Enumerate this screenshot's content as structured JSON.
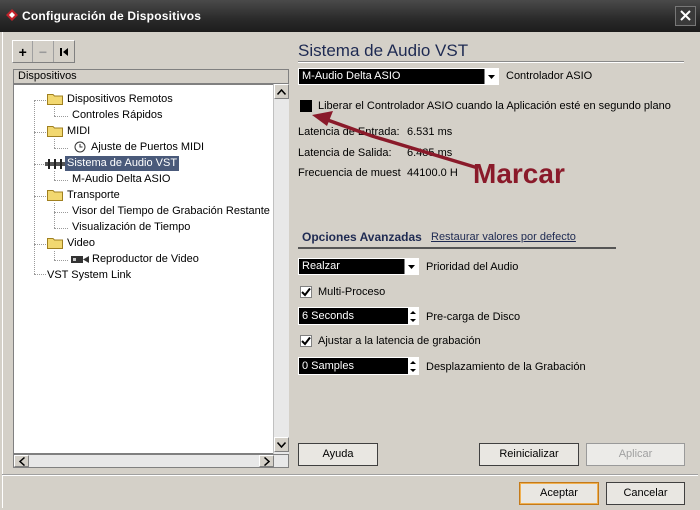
{
  "window": {
    "title": "Configuración de Dispositivos",
    "close_symbol": "✕"
  },
  "toolbar": {
    "add_symbol": "+",
    "remove_symbol": "−",
    "reset_symbol": "⏮"
  },
  "tree": {
    "header": "Dispositivos",
    "items": [
      {
        "label": "Dispositivos Remotos",
        "icon": "folder-icon"
      },
      {
        "label": "Controles Rápidos",
        "icon": null
      },
      {
        "label": "MIDI",
        "icon": "folder-icon"
      },
      {
        "label": "Ajuste de Puertos MIDI",
        "icon": "clock-icon"
      },
      {
        "label": "Sistema de Audio VST",
        "icon": "audio-system-icon",
        "selected": true
      },
      {
        "label": "M-Audio Delta ASIO",
        "icon": null
      },
      {
        "label": "Transporte",
        "icon": "folder-icon"
      },
      {
        "label": "Visor del Tiempo de Grabación Restante",
        "icon": null
      },
      {
        "label": "Visualización de Tiempo",
        "icon": null
      },
      {
        "label": "Video",
        "icon": "folder-icon"
      },
      {
        "label": "Reproductor de Video",
        "icon": "video-player-icon"
      },
      {
        "label": "VST System Link",
        "icon": null
      }
    ]
  },
  "panel": {
    "title": "Sistema de Audio VST",
    "asio_driver": {
      "value": "M-Audio Delta ASIO",
      "label": "Controlador ASIO"
    },
    "release_driver": {
      "checked": false,
      "label": "Liberar el Controlador ASIO cuando la Aplicación esté en segundo plano"
    },
    "input_latency": {
      "label": "Latencia de Entrada:",
      "value": "6.531 ms"
    },
    "output_latency": {
      "label": "Latencia de Salida:",
      "value": "6.485 ms"
    },
    "sample_rate": {
      "label": "Frecuencia de muest",
      "value": "44100.0 H"
    },
    "advanced": {
      "title": "Opciones Avanzadas",
      "restore_link": "Restaurar valores por defecto",
      "audio_priority": {
        "value": "Realzar",
        "label": "Prioridad del Audio"
      },
      "multiprocess": {
        "checked": true,
        "label": "Multi-Proceso"
      },
      "disk_preload": {
        "value": "6 Seconds",
        "label": "Pre-carga de Disco"
      },
      "adjust_latency": {
        "checked": true,
        "label": "Ajustar a la latencia de grabación"
      },
      "record_shift": {
        "value": "0 Samples",
        "label": "Desplazamiento de la Grabación"
      }
    },
    "buttons": {
      "help": "Ayuda",
      "reset": "Reinicializar",
      "apply": "Aplicar"
    }
  },
  "footer": {
    "accept": "Aceptar",
    "cancel": "Cancelar"
  },
  "annotation": {
    "text": "Marcar",
    "color": "#8a1a2a"
  },
  "colors": {
    "titlebar": "#2a2a2a",
    "panel_title": "#1e2a52",
    "selection": "#4a5a7a"
  }
}
